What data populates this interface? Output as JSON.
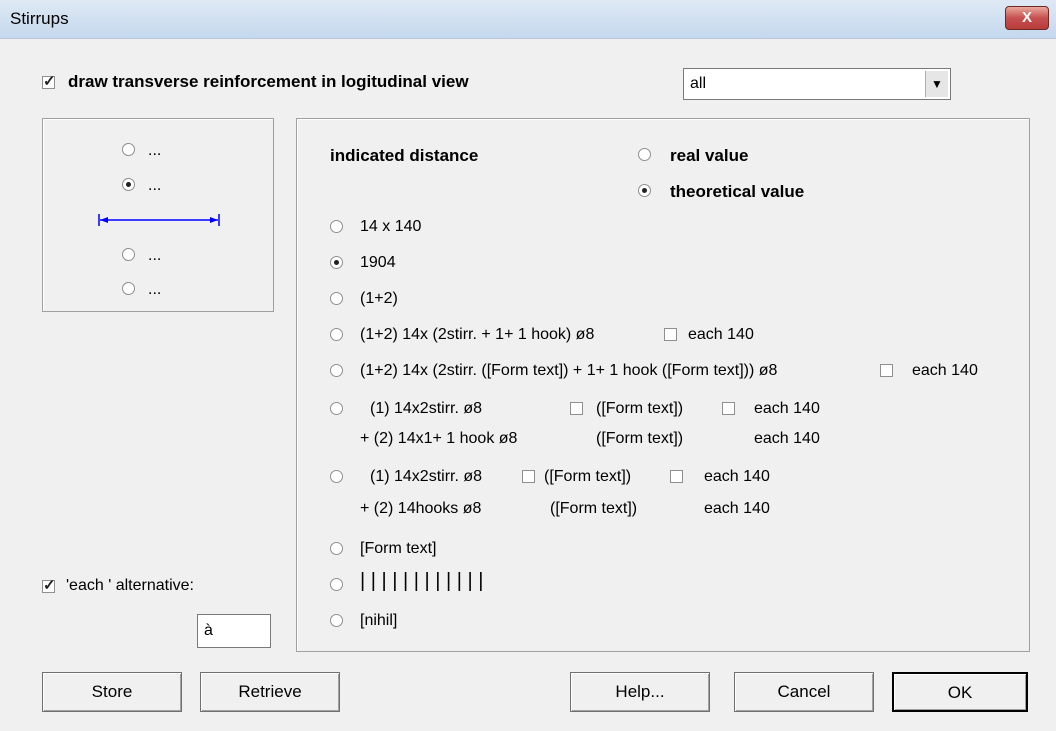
{
  "window": {
    "title": "Stirrups",
    "close_label": "X"
  },
  "top": {
    "draw_checkbox": {
      "label": "draw transverse reinforcement in logitudinal view",
      "checked": true
    },
    "select": {
      "value": "all"
    }
  },
  "left_panel": {
    "radios": [
      {
        "label": "...",
        "checked": false
      },
      {
        "label": "...",
        "checked": true
      },
      {
        "label": "...",
        "checked": false
      },
      {
        "label": "...",
        "checked": false
      }
    ]
  },
  "right_panel": {
    "indicated_distance": "indicated distance",
    "real_value": "real value",
    "theoretical_value": "theoretical value",
    "options": {
      "o1": "14 x 140",
      "o2": "1904",
      "o3": "(1+2)",
      "o4": "(1+2) 14x (2stirr. + 1+ 1 hook) ø8",
      "o4_each": "each  140",
      "o5": "(1+2) 14x (2stirr. ([Form text]) + 1+ 1 hook ([Form text])) ø8",
      "o5_each": "each  140",
      "o6_l1a": "(1) 14x2stirr. ø8",
      "o6_l1b": "([Form text])",
      "o6_l1c": "each  140",
      "o6_l2a": "+ (2) 14x1+ 1 hook ø8",
      "o6_l2b": "([Form text])",
      "o6_l2c": "each  140",
      "o7_l1a": "(1) 14x2stirr. ø8",
      "o7_l1b": "([Form text])",
      "o7_l1c": "each  140",
      "o7_l2a": "+ (2) 14hooks ø8",
      "o7_l2b": "([Form text])",
      "o7_l2c": "each  140",
      "o8": "[Form text]",
      "o9": "| | | |   |   |   |   |   | | | |",
      "o10": "[nihil]"
    }
  },
  "each_alternative": {
    "label": "'each ' alternative:",
    "checked": true,
    "value": "à"
  },
  "buttons": {
    "store": "Store",
    "retrieve": "Retrieve",
    "help": "Help...",
    "cancel": "Cancel",
    "ok": "OK"
  }
}
